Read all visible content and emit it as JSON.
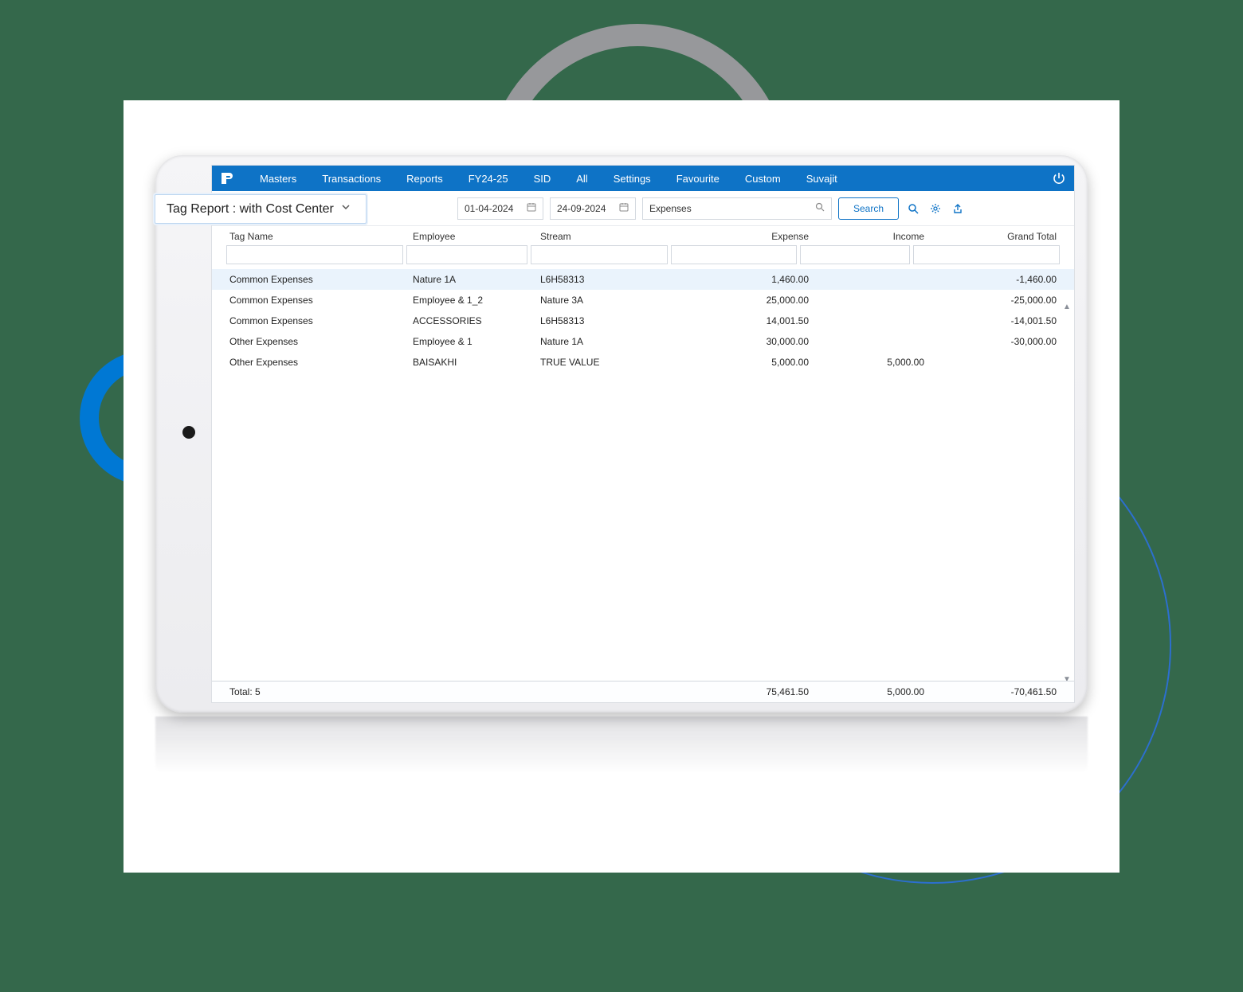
{
  "nav": {
    "items": [
      "Masters",
      "Transactions",
      "Reports",
      "FY24-25",
      "SID",
      "All",
      "Settings",
      "Favourite",
      "Custom",
      "Suvajit"
    ]
  },
  "filters": {
    "title": "Tag Report : with Cost Center",
    "from_date": "01-04-2024",
    "to_date": "24-09-2024",
    "type": "Expenses",
    "search_label": "Search"
  },
  "columns": {
    "tag": "Tag Name",
    "employee": "Employee",
    "stream": "Stream",
    "expense": "Expense",
    "income": "Income",
    "grand_total": "Grand Total"
  },
  "rows": [
    {
      "tag": "Common Expenses",
      "employee": "Nature 1A",
      "stream": "L6H58313",
      "expense": "1,460.00",
      "income": "",
      "grand_total": "-1,460.00"
    },
    {
      "tag": "Common Expenses",
      "employee": "Employee & 1_2",
      "stream": "Nature 3A",
      "expense": "25,000.00",
      "income": "",
      "grand_total": "-25,000.00"
    },
    {
      "tag": "Common Expenses",
      "employee": "ACCESSORIES",
      "stream": "L6H58313",
      "expense": "14,001.50",
      "income": "",
      "grand_total": "-14,001.50"
    },
    {
      "tag": "Other Expenses",
      "employee": "Employee & 1",
      "stream": "Nature 1A",
      "expense": "30,000.00",
      "income": "",
      "grand_total": "-30,000.00"
    },
    {
      "tag": "Other Expenses",
      "employee": "BAISAKHI",
      "stream": "TRUE VALUE",
      "expense": "5,000.00",
      "income": "5,000.00",
      "grand_total": ""
    }
  ],
  "totals": {
    "label": "Total: 5",
    "expense": "75,461.50",
    "income": "5,000.00",
    "grand_total": "-70,461.50"
  }
}
